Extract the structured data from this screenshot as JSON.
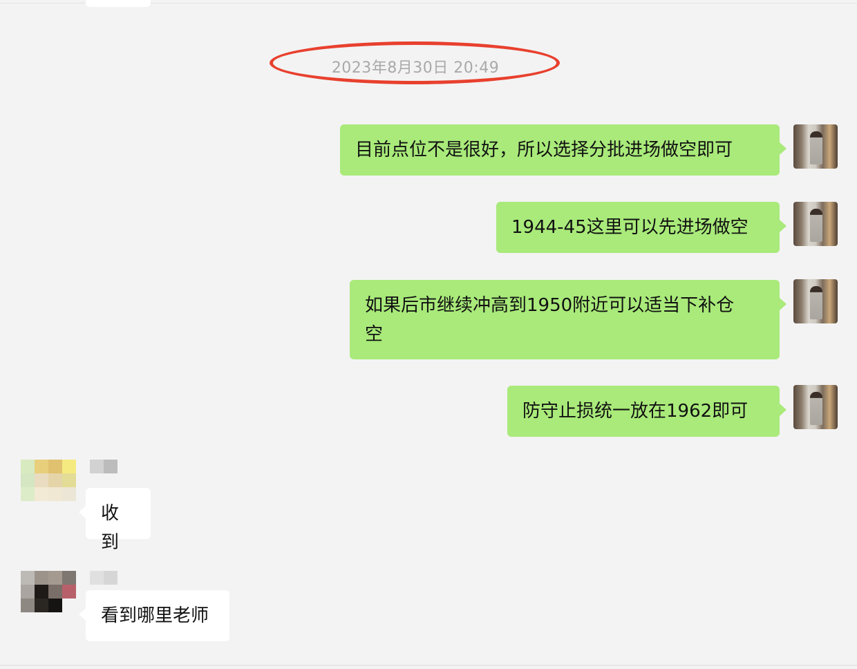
{
  "timestamp": "2023年8月30日 20:49",
  "colors": {
    "outgoing_bubble": "#a9ea7a",
    "incoming_bubble": "#ffffff",
    "highlight_ellipse": "#e8402e",
    "background": "#f3f3f3"
  },
  "messages": [
    {
      "direction": "out",
      "text": "目前点位不是很好，所以选择分批进场做空即可"
    },
    {
      "direction": "out",
      "text": "1944-45这里可以先进场做空"
    },
    {
      "direction": "out",
      "line1": "如果后市继续冲高到1950附近可以适当下补仓",
      "line2": "空"
    },
    {
      "direction": "out",
      "text": "防守止损统一放在1962即可"
    },
    {
      "direction": "in",
      "text": "收到"
    },
    {
      "direction": "in",
      "text": "看到哪里老师"
    }
  ]
}
